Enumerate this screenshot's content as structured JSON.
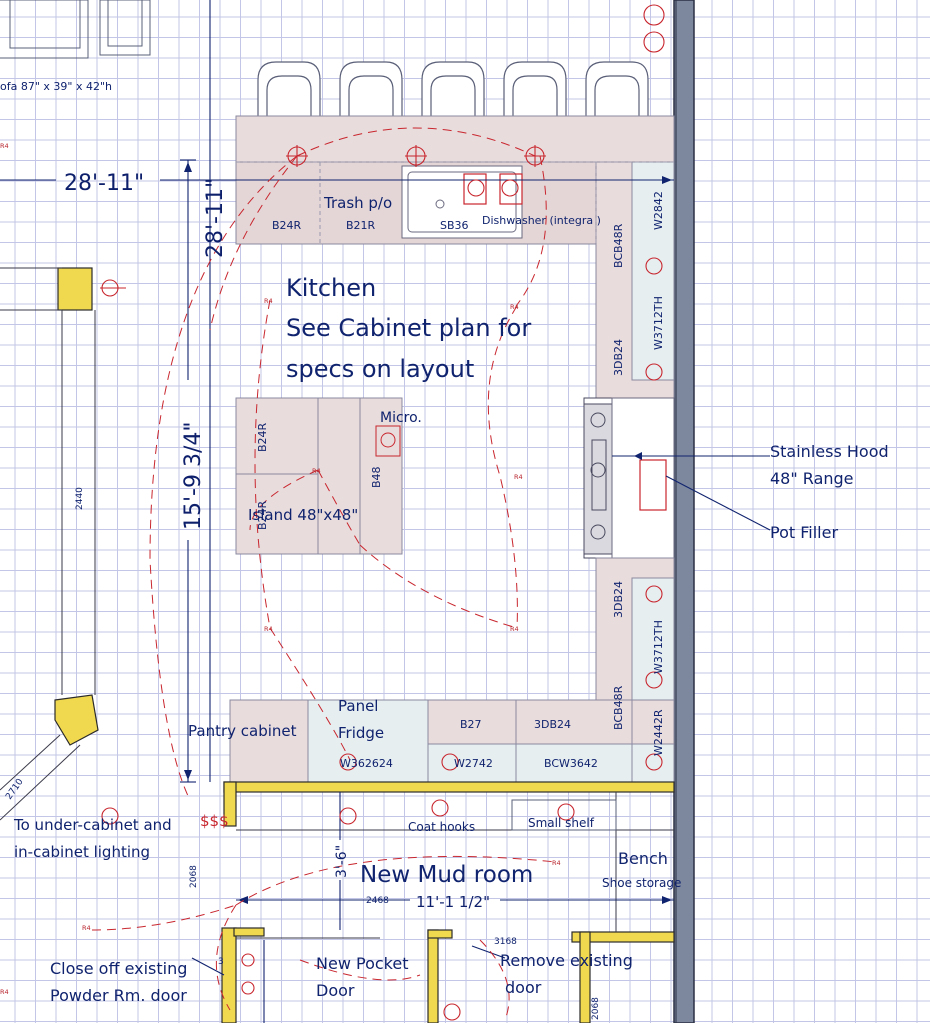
{
  "room_labels": {
    "kitchen_title": "Kitchen",
    "kitchen_note_line1": "See Cabinet plan for",
    "kitchen_note_line2": "specs on layout",
    "mud_room": "New Mud room",
    "island": "Island 48\"x48\""
  },
  "dimensions": {
    "overall_horizontal": "28'-11\"",
    "overall_vertical": "28'-11\"",
    "kitchen_depth": "15'-9 3/4\"",
    "mud_room_width": "11'-1 1/2\"",
    "mud_room_depth": "3'-6\""
  },
  "cabinets": {
    "b24r_top": "B24R",
    "b21r": "B21R",
    "sb36": "SB36",
    "trash": "Trash p/o",
    "dishwasher": "Dishwasher (integra  )",
    "w2842": "W2842",
    "bcb48r_top": "BCB48R",
    "w3712th_top": "W3712TH",
    "3db24_top": "3DB24",
    "b24r_island_top": "B24R",
    "b48": "B48",
    "b24r_island_bottom": "B24R",
    "micro": "Micro.",
    "3db24_bottom": "3DB24",
    "w3712th_bottom": "W3712TH",
    "bcb48r_bottom": "BCB48R",
    "w2442r": "W2442R",
    "b27": "B27",
    "3db24_mid": "3DB24",
    "w362624": "W362624",
    "w2742": "W2742",
    "bcw3642": "BCW3642"
  },
  "annotations": {
    "stainless_hood": "Stainless Hood",
    "range": "48\" Range",
    "pot_filler": "Pot Filler",
    "pantry": "Pantry cabinet",
    "panel_fridge_1": "Panel",
    "panel_fridge_2": "Fridge",
    "under_cabinet_1": "To under-cabinet and",
    "under_cabinet_2": "in-cabinet lighting",
    "coat_hooks": "Coat hooks",
    "small_shelf": "Small shelf",
    "bench": "Bench",
    "shoe_storage": "Shoe storage",
    "close_off_1": "Close off existing",
    "close_off_2": "Powder Rm. door",
    "new_pocket_1": "New Pocket",
    "new_pocket_2": "Door",
    "remove_existing_1": "Remove existing",
    "remove_existing_2": "door",
    "sofa": "ofa 87\" x 39\" x 42\"h"
  },
  "small_codes": {
    "door_2468": "2468",
    "door_2068_left": "2068",
    "door_2068_bottom": "2068",
    "door_3168": "3168",
    "window_2440": "2440",
    "window_3": "3",
    "window_2710": "2710"
  },
  "electrical": {
    "r4": "R4",
    "sss": "$$$"
  },
  "colors": {
    "grid": "#c3c6e6",
    "text": "#10236e",
    "cabinet_fill": "#e9dcdc",
    "appliance_fill": "#e6eef0",
    "wall_blue": "#7d879e",
    "wall_yellow": "#f1d94f",
    "electrical_red": "#c8262e"
  }
}
